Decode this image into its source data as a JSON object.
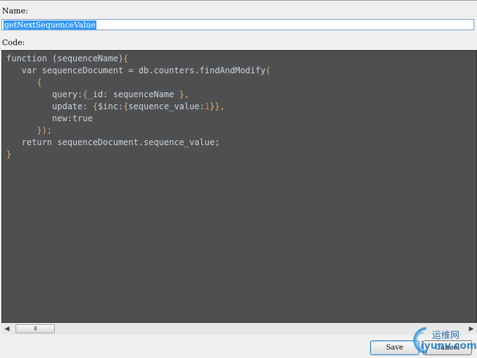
{
  "form": {
    "name_label": "Name:",
    "name_value": "getNextSequenceValue",
    "code_label": "Code:"
  },
  "editor": {
    "lines": [
      {
        "segments": [
          {
            "t": "function (sequenceName)",
            "c": "k"
          },
          {
            "t": "{",
            "c": "p"
          }
        ]
      },
      {
        "segments": [
          {
            "t": "   var sequenceDocument = db.counters.findAndModify",
            "c": "k"
          },
          {
            "t": "(",
            "c": "p"
          }
        ]
      },
      {
        "segments": [
          {
            "t": "      {",
            "c": "p"
          }
        ]
      },
      {
        "segments": [
          {
            "t": "         query:",
            "c": "k"
          },
          {
            "t": "{",
            "c": "p"
          },
          {
            "t": "_id: sequenceName ",
            "c": "k"
          },
          {
            "t": "},",
            "c": "p"
          }
        ]
      },
      {
        "segments": [
          {
            "t": "         update: ",
            "c": "k"
          },
          {
            "t": "{",
            "c": "p"
          },
          {
            "t": "$inc:",
            "c": "k"
          },
          {
            "t": "{",
            "c": "p"
          },
          {
            "t": "sequence_value:",
            "c": "k"
          },
          {
            "t": "1",
            "c": "n"
          },
          {
            "t": "}},",
            "c": "p"
          }
        ]
      },
      {
        "segments": [
          {
            "t": "         new:true",
            "c": "k"
          }
        ]
      },
      {
        "segments": [
          {
            "t": "      });",
            "c": "p"
          }
        ]
      },
      {
        "segments": [
          {
            "t": "   return sequenceDocument.sequence_value;",
            "c": "k"
          }
        ]
      },
      {
        "segments": [
          {
            "t": "}",
            "c": "p"
          }
        ]
      }
    ]
  },
  "scrollbar": {
    "left_arrow": "◀",
    "right_arrow": "▶",
    "thumb_grip": "III"
  },
  "buttons": {
    "save_label": "Save",
    "cancel_label": "Cancel"
  },
  "watermark": {
    "cn": "运维网",
    "en": "iyunv.com"
  }
}
